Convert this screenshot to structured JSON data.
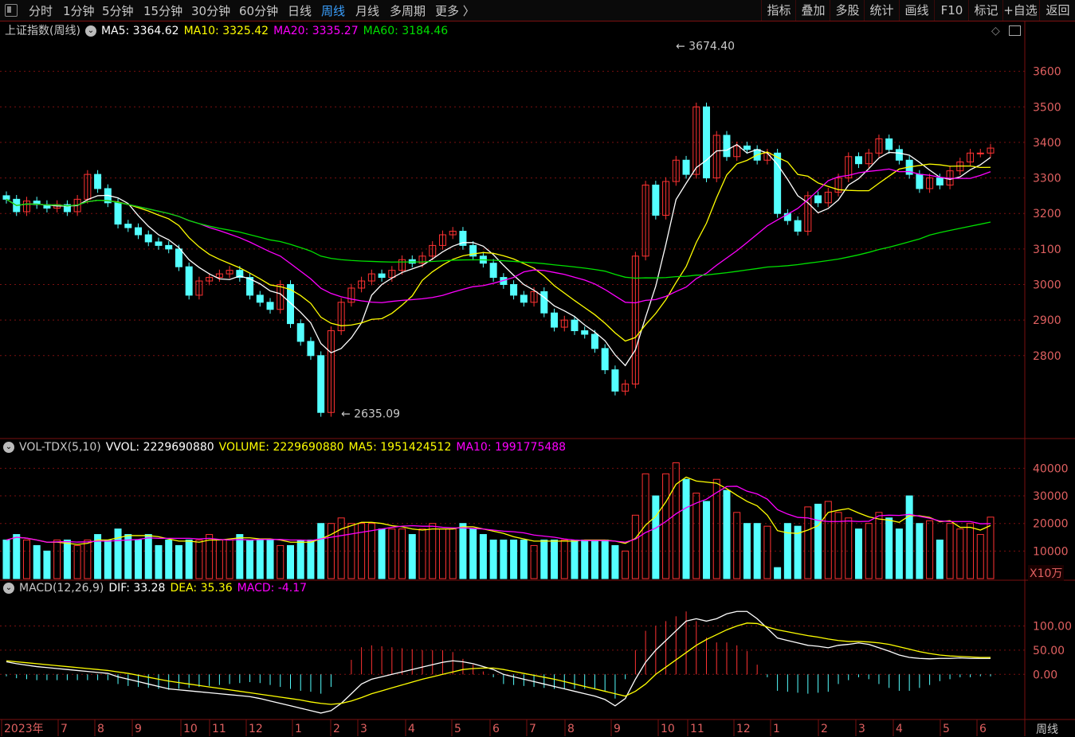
{
  "toolbar": {
    "periods": [
      "分时",
      "1分钟",
      "5分钟",
      "15分钟",
      "30分钟",
      "60分钟",
      "日线",
      "周线",
      "月线",
      "多周期",
      "更多 〉"
    ],
    "active_period": "周线",
    "right_buttons": [
      "指标",
      "叠加",
      "多股",
      "统计",
      "画线",
      "F10",
      "标记",
      "+自选",
      "返回"
    ]
  },
  "main_legend": {
    "title": "上证指数(周线)",
    "items": [
      {
        "label": "MA5:",
        "value": "3364.62",
        "color": "#ffffff"
      },
      {
        "label": "MA10:",
        "value": "3325.42",
        "color": "#ffff00"
      },
      {
        "label": "MA20:",
        "value": "3335.27",
        "color": "#ff00ff"
      },
      {
        "label": "MA60:",
        "value": "3184.46",
        "color": "#00e000"
      }
    ]
  },
  "vol_legend": {
    "title": "VOL-TDX(5,10)",
    "items": [
      {
        "label": "VVOL:",
        "value": "2229690880",
        "color": "#ffffff"
      },
      {
        "label": "VOLUME:",
        "value": "2229690880",
        "color": "#ffff00"
      },
      {
        "label": "MA5:",
        "value": "1951424512",
        "color": "#ffff00"
      },
      {
        "label": "MA10:",
        "value": "1991775488",
        "color": "#ff00ff"
      }
    ]
  },
  "macd_legend": {
    "title": "MACD(12,26,9)",
    "items": [
      {
        "label": "DIF:",
        "value": "33.28",
        "color": "#ffffff"
      },
      {
        "label": "DEA:",
        "value": "35.36",
        "color": "#ffff00"
      },
      {
        "label": "MACD:",
        "value": "-4.17",
        "color": "#ff00ff"
      }
    ]
  },
  "vol_unit": "X10万",
  "period_label": "周线",
  "colors": {
    "up": "#ff3232",
    "down": "#54ffff",
    "grid": "#7a1010",
    "axis": "#e06060"
  },
  "chart_data": [
    {
      "type": "candlestick",
      "title": "上证指数(周线)",
      "y_ticks": [
        2800,
        2900,
        3000,
        3100,
        3200,
        3300,
        3400,
        3500,
        3600
      ],
      "ylim": [
        2580,
        3700
      ],
      "annotations": [
        {
          "text": "3674.40",
          "value": 3674.4
        },
        {
          "text": "2635.09",
          "value": 2635.09
        }
      ],
      "x_labels": [
        "2023年",
        "7",
        "8",
        "9",
        "10",
        "11",
        "12",
        "1",
        "2",
        "3",
        "4",
        "5",
        "6",
        "7",
        "8",
        "9",
        "10",
        "11",
        "12",
        "1",
        "2",
        "3",
        "4",
        "5",
        "6"
      ],
      "close": [
        3240,
        3205,
        3235,
        3225,
        3215,
        3225,
        3205,
        3240,
        3310,
        3270,
        3230,
        3170,
        3160,
        3140,
        3120,
        3110,
        3100,
        3050,
        2970,
        3010,
        3020,
        3030,
        3040,
        3020,
        2970,
        2950,
        2930,
        3000,
        2890,
        2840,
        2800,
        2640,
        2870,
        2950,
        2990,
        3010,
        3030,
        3020,
        3040,
        3070,
        3060,
        3080,
        3110,
        3140,
        3150,
        3110,
        3080,
        3060,
        3020,
        3000,
        2970,
        2950,
        2980,
        2920,
        2880,
        2900,
        2870,
        2860,
        2820,
        2760,
        2700,
        2720,
        3080,
        3280,
        3195,
        3290,
        3350,
        3310,
        3500,
        3300,
        3420,
        3360,
        3390,
        3380,
        3350,
        3370,
        3200,
        3180,
        3150,
        3250,
        3230,
        3260,
        3300,
        3360,
        3340,
        3370,
        3410,
        3380,
        3350,
        3310,
        3270,
        3300,
        3280,
        3320,
        3345,
        3370,
        3370,
        3384
      ]
    },
    {
      "type": "bar",
      "title": "VOL-TDX(5,10)",
      "y_ticks": [
        10000,
        20000,
        30000,
        40000
      ],
      "ylim": [
        0,
        43000
      ],
      "values": [
        14000,
        16000,
        14000,
        12000,
        10000,
        14000,
        14000,
        12000,
        14000,
        16000,
        14000,
        18000,
        16000,
        14000,
        16000,
        12000,
        14000,
        12000,
        14000,
        14000,
        16000,
        14000,
        14000,
        16000,
        14000,
        14000,
        14000,
        12000,
        12000,
        14000,
        14000,
        20000,
        20000,
        22000,
        20000,
        20000,
        20000,
        18000,
        18000,
        18000,
        16000,
        18000,
        20000,
        18000,
        18000,
        20000,
        18000,
        16000,
        14000,
        14000,
        14000,
        14000,
        12000,
        14000,
        14000,
        14000,
        14000,
        14000,
        14000,
        14000,
        12000,
        10000,
        23000,
        38000,
        30000,
        38000,
        42000,
        36000,
        31000,
        28000,
        36000,
        32000,
        24000,
        20000,
        20000,
        19000,
        4000,
        20000,
        19000,
        26000,
        27000,
        28000,
        24000,
        22000,
        18000,
        20000,
        24000,
        22000,
        18000,
        30000,
        20000,
        21000,
        14000,
        20000,
        18000,
        20000,
        16000,
        22300
      ]
    },
    {
      "type": "line",
      "title": "MACD(12,26,9)",
      "y_ticks": [
        0,
        50,
        100
      ],
      "ylim": [
        -90,
        160
      ],
      "series": [
        {
          "name": "DIF",
          "values": [
            26,
            22,
            19,
            16,
            14,
            12,
            10,
            8,
            6,
            4,
            2,
            -5,
            -10,
            -15,
            -20,
            -25,
            -30,
            -32,
            -34,
            -36,
            -38,
            -40,
            -42,
            -44,
            -46,
            -50,
            -55,
            -60,
            -65,
            -70,
            -75,
            -80,
            -75,
            -60,
            -40,
            -20,
            -10,
            -5,
            0,
            5,
            10,
            15,
            20,
            25,
            28,
            26,
            22,
            16,
            10,
            0,
            -5,
            -10,
            -15,
            -20,
            -25,
            -30,
            -35,
            -40,
            -45,
            -52,
            -65,
            -50,
            -10,
            25,
            50,
            70,
            90,
            110,
            115,
            110,
            115,
            125,
            130,
            130,
            115,
            95,
            75,
            70,
            65,
            60,
            58,
            55,
            60,
            62,
            65,
            62,
            55,
            48,
            40,
            35,
            33,
            32,
            33,
            33,
            34,
            33,
            33,
            33
          ]
        },
        {
          "name": "DEA",
          "values": [
            28,
            26,
            24,
            22,
            20,
            18,
            16,
            14,
            12,
            10,
            8,
            5,
            2,
            -2,
            -6,
            -10,
            -14,
            -17,
            -20,
            -23,
            -26,
            -29,
            -32,
            -35,
            -38,
            -41,
            -44,
            -47,
            -50,
            -53,
            -57,
            -60,
            -62,
            -60,
            -55,
            -48,
            -40,
            -34,
            -28,
            -22,
            -16,
            -10,
            -5,
            0,
            5,
            10,
            12,
            13,
            13,
            10,
            6,
            2,
            -2,
            -6,
            -10,
            -15,
            -20,
            -25,
            -30,
            -35,
            -40,
            -45,
            -35,
            -20,
            0,
            15,
            30,
            45,
            60,
            72,
            82,
            92,
            100,
            106,
            105,
            98,
            92,
            88,
            84,
            80,
            77,
            73,
            70,
            68,
            68,
            67,
            65,
            62,
            57,
            52,
            47,
            43,
            40,
            38,
            37,
            36,
            35,
            35
          ]
        }
      ]
    }
  ]
}
